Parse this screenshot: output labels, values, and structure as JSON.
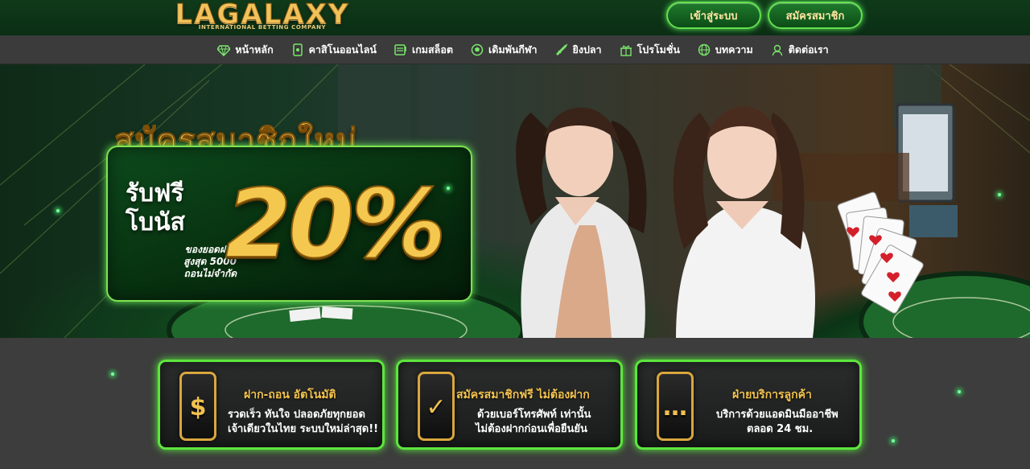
{
  "header": {
    "logo_text": "LAGALAXY",
    "logo_subtitle": "INTERNATIONAL BETTING COMPANY",
    "login_label": "เข้าสู่ระบบ",
    "register_label": "สมัครสมาชิก",
    "accent_color": "#65e04f",
    "gold_color": "#f1c25b"
  },
  "nav": {
    "items": [
      {
        "label": "หน้าหลัก",
        "icon": "diamond-icon"
      },
      {
        "label": "คาสิโนออนไลน์",
        "icon": "card-icon"
      },
      {
        "label": "เกมสล็อต",
        "icon": "slot-machine-icon"
      },
      {
        "label": "เดิมพันกีฬา",
        "icon": "soccer-ball-icon"
      },
      {
        "label": "ยิงปลา",
        "icon": "fish-icon"
      },
      {
        "label": "โปรโมชั่น",
        "icon": "gift-icon"
      },
      {
        "label": "บทความ",
        "icon": "globe-icon"
      },
      {
        "label": "ติดต่อเรา",
        "icon": "support-agent-icon"
      }
    ]
  },
  "hero": {
    "title": "สมัครสมาชิกใหม่",
    "bonus_line1": "รับฟรี",
    "bonus_line2": "โบนัส",
    "percent": "20%",
    "small_line1": "ของยอดฝาก",
    "small_line2": "สูงสุด 5000",
    "small_line3": "ถอนไม่จำกัด"
  },
  "cards": [
    {
      "title": "ฝาก-ถอน อัตโนมัติ",
      "line1": "รวดเร็ว ทันใจ ปลอดภัยทุกยอด",
      "line2": "เจ้าเดียวในไทย ระบบใหม่ล่าสุด!!",
      "icon": "dollar-icon",
      "symbol": "$"
    },
    {
      "title": "สมัครสมาชิกฟรี ไม่ต้องฝาก",
      "line1": "ด้วยเบอร์โทรศัพท์ เท่านั้น",
      "line2": "ไม่ต้องฝากก่อนเพื่อยืนยัน",
      "icon": "verified-check-icon",
      "symbol": "✓"
    },
    {
      "title": "ฝ่ายบริการลูกค้า",
      "line1": "บริการด้วยแอดมินมืออาชีพ",
      "line2": "ตลอด 24 ชม.",
      "icon": "chat-bubble-icon",
      "symbol": "…"
    }
  ]
}
